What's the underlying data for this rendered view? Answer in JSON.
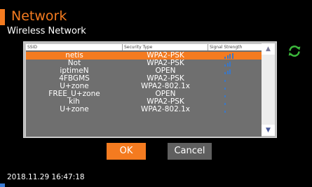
{
  "header": {
    "title": "Network",
    "subtitle": "Wireless Network"
  },
  "table": {
    "columns": [
      "SSID",
      "Security Type",
      "Signal Strength"
    ],
    "rows": [
      {
        "ssid": "netis",
        "security": "WPA2-PSK",
        "signal": 4,
        "selected": true
      },
      {
        "ssid": "Not",
        "security": "WPA2-PSK",
        "signal": 3,
        "selected": false
      },
      {
        "ssid": "iptimeN",
        "security": "OPEN",
        "signal": 3,
        "selected": false
      },
      {
        "ssid": "4FBGMS",
        "security": "WPA2-PSK",
        "signal": 1,
        "selected": false
      },
      {
        "ssid": "U+zone",
        "security": "WPA2-802.1x",
        "signal": 1,
        "selected": false
      },
      {
        "ssid": "FREE_U+zone",
        "security": "OPEN",
        "signal": 1,
        "selected": false
      },
      {
        "ssid": "kih",
        "security": "WPA2-PSK",
        "signal": 1,
        "selected": false
      },
      {
        "ssid": "U+zone",
        "security": "WPA2-802.1x",
        "signal": 1,
        "selected": false
      }
    ]
  },
  "scrollbar": {
    "up_icon": "▲",
    "down_icon": "▼"
  },
  "refresh_icon": "refresh-icon",
  "buttons": {
    "ok": "OK",
    "cancel": "Cancel"
  },
  "footer": {
    "datetime": "2018.11.29  16:47:18"
  },
  "colors": {
    "accent": "#f47b20",
    "signal_bar": "#3a78c8",
    "table_bg": "#6f6f6f"
  }
}
